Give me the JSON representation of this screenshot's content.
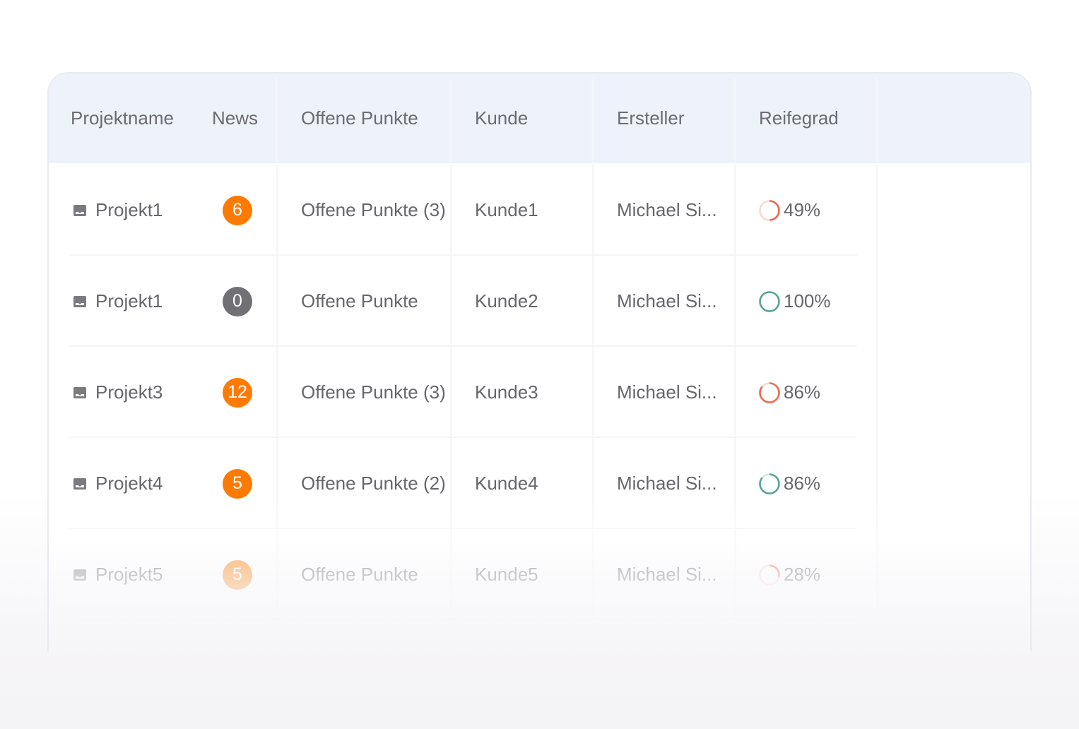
{
  "table": {
    "columns": {
      "name": "Projektname",
      "news": "News",
      "open": "Offene Punkte",
      "customer": "Kunde",
      "creator": "Ersteller",
      "maturity": "Reifegrad"
    },
    "rows": [
      {
        "name": "Projekt1",
        "news": "6",
        "news_color": "#ff7a00",
        "open": "Offene Punkte (3)",
        "customer": "Kunde1",
        "creator": "Michael Si...",
        "maturity": "49%",
        "maturity_value": 0.49,
        "ring_color": "#f06a4e"
      },
      {
        "name": "Projekt1",
        "news": "0",
        "news_color": "#707075",
        "open": "Offene Punkte",
        "customer": "Kunde2",
        "creator": "Michael Si...",
        "maturity": "100%",
        "maturity_value": 1.0,
        "ring_color": "#5aa497"
      },
      {
        "name": "Projekt3",
        "news": "12",
        "news_color": "#ff7a00",
        "open": "Offene Punkte (3)",
        "customer": "Kunde3",
        "creator": "Michael Si...",
        "maturity": "86%",
        "maturity_value": 0.86,
        "ring_color": "#f06a4e"
      },
      {
        "name": "Projekt4",
        "news": "5",
        "news_color": "#ff7a00",
        "open": "Offene Punkte (2)",
        "customer": "Kunde4",
        "creator": "Michael Si...",
        "maturity": "86%",
        "maturity_value": 0.86,
        "ring_color": "#5aa497"
      },
      {
        "name": "Projekt5",
        "news": "5",
        "news_color": "#ff7a00",
        "open": "Offene Punkte",
        "customer": "Kunde5",
        "creator": "Michael Si...",
        "maturity": "28%",
        "maturity_value": 0.28,
        "ring_color": "#f06a4e"
      }
    ]
  },
  "icons": {
    "project": "project-icon",
    "maturity": "progress-ring-icon"
  }
}
